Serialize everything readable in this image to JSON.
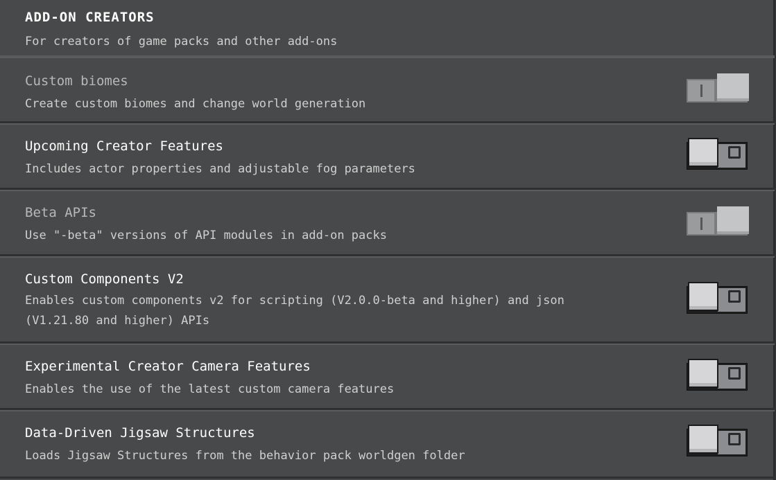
{
  "section": {
    "title": "ADD-ON CREATORS",
    "subtitle": "For creators of game packs and other add-ons"
  },
  "experiments": [
    {
      "title": "Custom biomes",
      "description": "Create custom biomes and change world generation",
      "enabled": true,
      "locked": true
    },
    {
      "title": "Upcoming Creator Features",
      "description": "Includes actor properties and adjustable fog parameters",
      "enabled": false,
      "locked": false
    },
    {
      "title": "Beta APIs",
      "description": "Use \"-beta\" versions of API modules in add-on packs",
      "enabled": true,
      "locked": true
    },
    {
      "title": "Custom Components V2",
      "description": "Enables custom components v2 for scripting (V2.0.0-beta and higher) and json (V1.21.80 and higher) APIs",
      "enabled": false,
      "locked": false
    },
    {
      "title": "Experimental Creator Camera Features",
      "description": "Enables the use of the latest custom camera features",
      "enabled": false,
      "locked": false
    },
    {
      "title": "Data-Driven Jigsaw Structures",
      "description": "Loads Jigsaw Structures from the behavior pack worldgen folder",
      "enabled": false,
      "locked": false
    }
  ],
  "colors": {
    "panel": "#48494a",
    "text_primary": "#ffffff",
    "text_secondary": "#d0d0d0",
    "text_disabled": "#b8b8b8"
  },
  "icons": {
    "toggle_on": "toggle-on-icon",
    "toggle_off": "toggle-off-icon"
  }
}
